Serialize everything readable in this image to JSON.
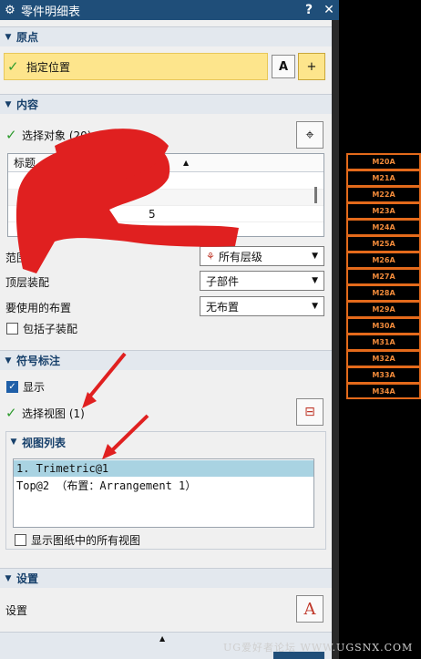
{
  "window": {
    "title": "零件明细表",
    "help_label": "?",
    "close_label": "✕"
  },
  "origin": {
    "header": "原点",
    "specify_location": "指定位置"
  },
  "content": {
    "header": "内容",
    "select_object": "选择对象 (20)",
    "table": {
      "header_col1": "标题",
      "visible_fragment": "5"
    },
    "range_label": "范围",
    "range_value": "所有层级",
    "top_assembly_label": "顶层装配",
    "top_assembly_value": "子部件",
    "layout_label": "要使用的布置",
    "layout_value": "无布置",
    "include_subassembly": "包括子装配"
  },
  "symbol_annotation": {
    "header": "符号标注",
    "show_label": "显示",
    "show_checked": true,
    "select_view": "选择视图 (1)"
  },
  "view_list": {
    "header": "视图列表",
    "items": [
      "1. Trimetric@1",
      "Top@2 （布置：Arrangement 1）"
    ],
    "selected_index": 0,
    "show_all_views": "显示图纸中的所有视图"
  },
  "settings": {
    "header": "设置",
    "label": "设置"
  },
  "tags": [
    "M20A",
    "M21A",
    "M22A",
    "M23A",
    "M24A",
    "M25A",
    "M26A",
    "M27A",
    "M28A",
    "M29A",
    "M30A",
    "M31A",
    "M32A",
    "M33A",
    "M34A"
  ],
  "watermark": "UG爱好者论坛 WWW.UGSNX.COM",
  "colors": {
    "title_bar": "#1f4e79",
    "section_text": "#17406b",
    "highlight_field": "#fde58c",
    "list_selection": "#a9d3e2",
    "tag_border": "#e46a1b",
    "annotation_red": "#e02020"
  }
}
